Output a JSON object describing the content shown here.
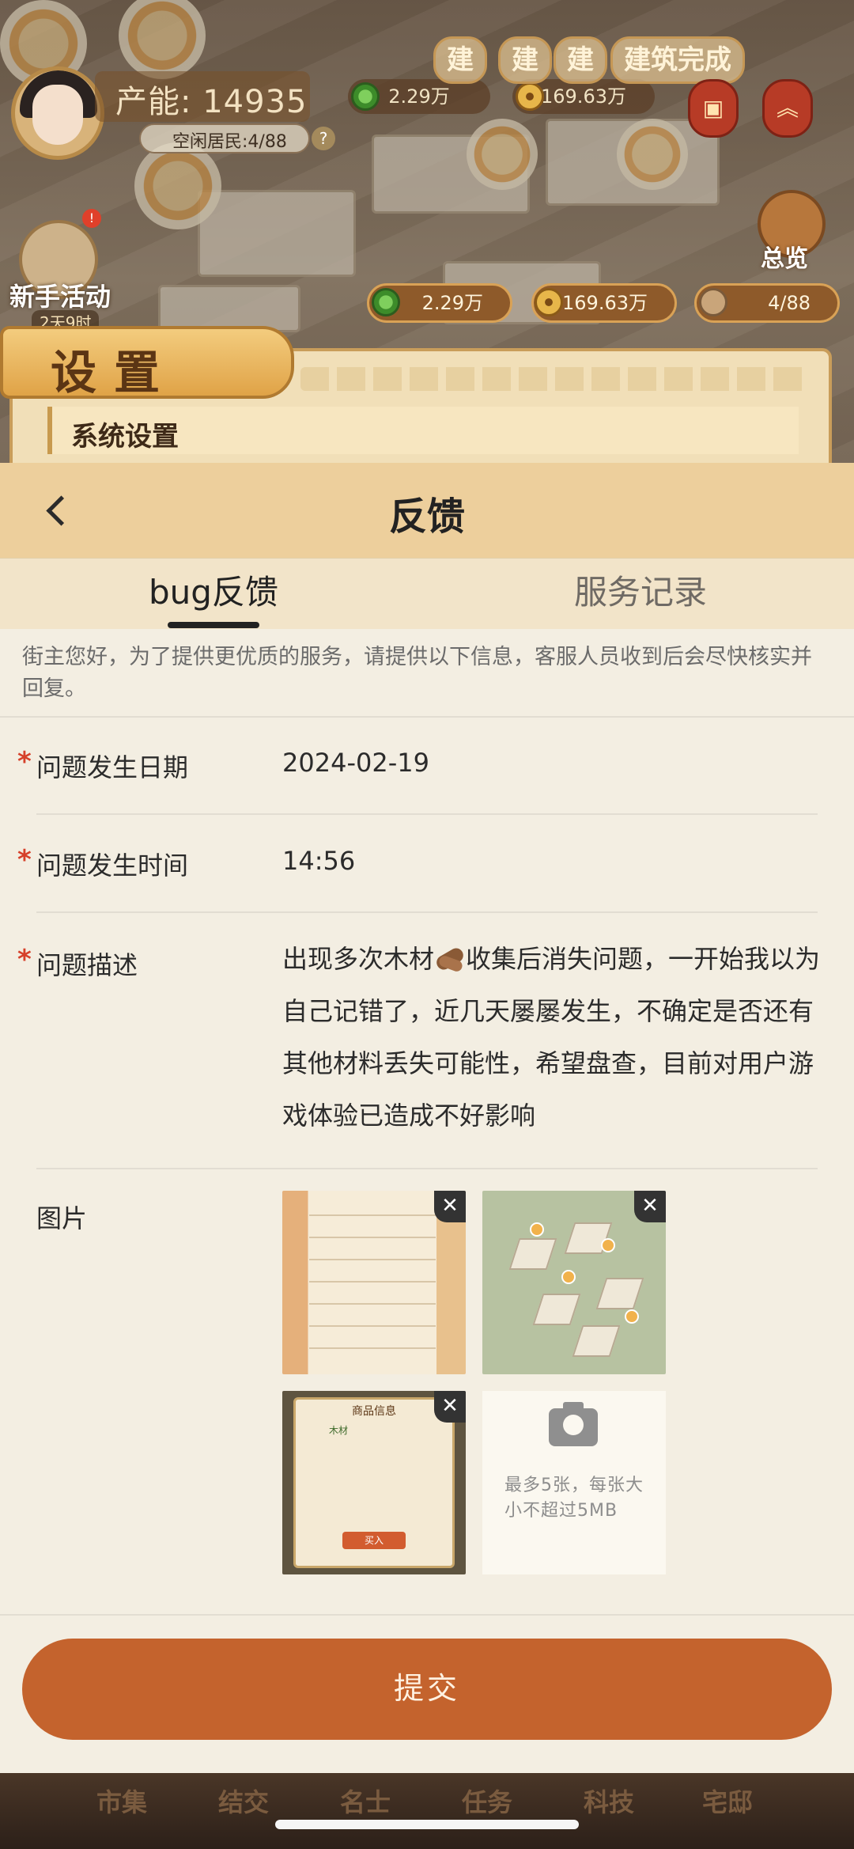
{
  "game": {
    "capacity_label": "产能: 14935",
    "idle_residents": "空闲居民:4/88",
    "help": "?",
    "top_jade": "2.29万",
    "top_coins": "169.63万",
    "build_flags": [
      "建",
      "建",
      "建",
      "建筑完成"
    ],
    "overview_label": "总览",
    "newbie_label": "新手活动",
    "newbie_timer": "2天9时",
    "chip_jade": "2.29万",
    "chip_coins": "169.63万",
    "chip_residents": "4/88",
    "settings_title": "设置",
    "system_settings": "系统设置",
    "nav": [
      "市集",
      "结交",
      "名士",
      "任务",
      "科技",
      "宅邸"
    ]
  },
  "feedback": {
    "title": "反馈",
    "tabs": [
      {
        "label": "bug反馈",
        "active": true
      },
      {
        "label": "服务记录",
        "active": false
      }
    ],
    "notice": "街主您好，为了提供更优质的服务，请提供以下信息，客服人员收到后会尽快核实并回复。",
    "required_mark": "*",
    "date_label": "问题发生日期",
    "date_value": "2024-02-19",
    "time_label": "问题发生时间",
    "time_value": "14:56",
    "desc_label": "问题描述",
    "desc_part1": "出现多次木材",
    "desc_part2": "收集后消失问题，一开始我以为自己记错了，近几天屡屡发生，不确定是否还有其他材料丢失可能性，希望盘查，目前对用户游戏体验已造成不好影响",
    "images_label": "图片",
    "thumb3_title": "商品信息",
    "thumb3_item": "木材",
    "thumb3_buy": "买入",
    "upload_hint": "最多5张，每张大小不超过5MB",
    "close_glyph": "✕",
    "submit_label": "提交"
  }
}
